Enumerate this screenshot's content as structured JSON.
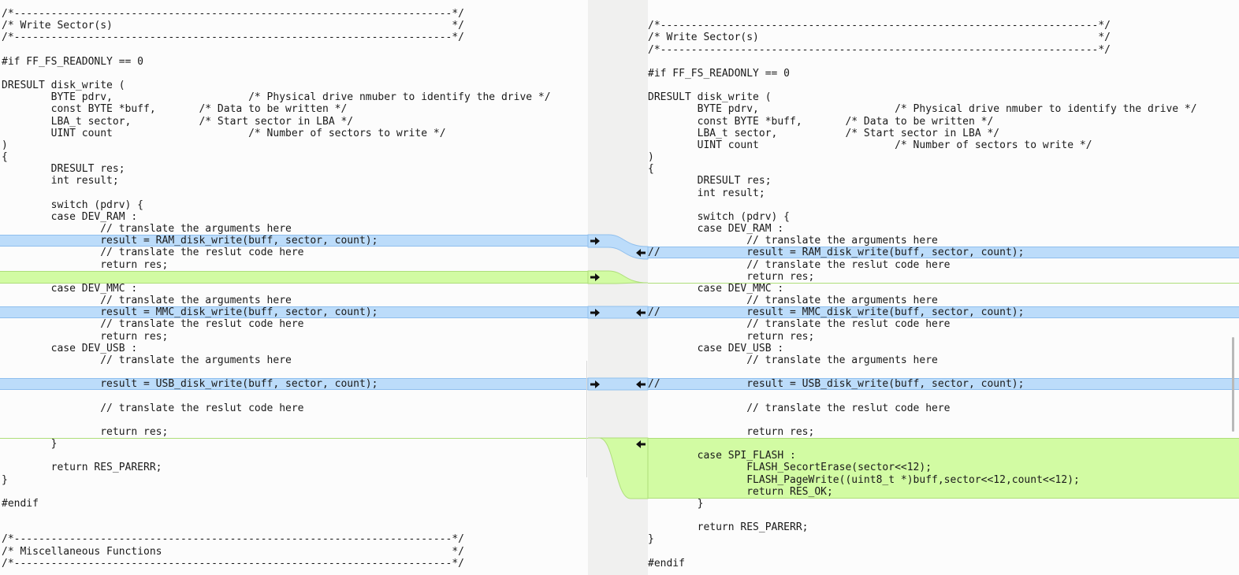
{
  "left": {
    "lines": [
      "/*-----------------------------------------------------------------------*/",
      "/* Write Sector(s)                                                       */",
      "/*-----------------------------------------------------------------------*/",
      "",
      "#if FF_FS_READONLY == 0",
      "",
      "DRESULT disk_write (",
      "        BYTE pdrv,                      /* Physical drive nmuber to identify the drive */",
      "        const BYTE *buff,       /* Data to be written */",
      "        LBA_t sector,           /* Start sector in LBA */",
      "        UINT count                      /* Number of sectors to write */",
      ")",
      "{",
      "        DRESULT res;",
      "        int result;",
      "",
      "        switch (pdrv) {",
      "        case DEV_RAM :",
      "                // translate the arguments here",
      "                result = RAM_disk_write(buff, sector, count);",
      "                // translate the reslut code here",
      "                return res;",
      "",
      "        case DEV_MMC :",
      "                // translate the arguments here",
      "                result = MMC_disk_write(buff, sector, count);",
      "                // translate the reslut code here",
      "                return res;",
      "        case DEV_USB :",
      "                // translate the arguments here",
      "",
      "                result = USB_disk_write(buff, sector, count);",
      "",
      "                // translate the reslut code here",
      "",
      "                return res;",
      "        }",
      "",
      "        return RES_PARERR;",
      "}",
      "",
      "#endif",
      "",
      "",
      "/*-----------------------------------------------------------------------*/",
      "/* Miscellaneous Functions                                               */",
      "/*-----------------------------------------------------------------------*/"
    ]
  },
  "right": {
    "lines": [
      "",
      "/*-----------------------------------------------------------------------*/",
      "/* Write Sector(s)                                                       */",
      "/*-----------------------------------------------------------------------*/",
      "",
      "#if FF_FS_READONLY == 0",
      "",
      "DRESULT disk_write (",
      "        BYTE pdrv,                      /* Physical drive nmuber to identify the drive */",
      "        const BYTE *buff,       /* Data to be written */",
      "        LBA_t sector,           /* Start sector in LBA */",
      "        UINT count                      /* Number of sectors to write */",
      ")",
      "{",
      "        DRESULT res;",
      "        int result;",
      "",
      "        switch (pdrv) {",
      "        case DEV_RAM :",
      "                // translate the arguments here",
      "//              result = RAM_disk_write(buff, sector, count);",
      "                // translate the reslut code here",
      "                return res;",
      "        case DEV_MMC :",
      "                // translate the arguments here",
      "//              result = MMC_disk_write(buff, sector, count);",
      "                // translate the reslut code here",
      "                return res;",
      "        case DEV_USB :",
      "                // translate the arguments here",
      "",
      "//              result = USB_disk_write(buff, sector, count);",
      "",
      "                // translate the reslut code here",
      "",
      "                return res;",
      "",
      "        case SPI_FLASH :",
      "                FLASH_SecortErase(sector<<12);",
      "                FLASH_PageWrite((uint8_t *)buff,sector<<12,count<<12);",
      "                return RES_OK;",
      "        }",
      "",
      "        return RES_PARERR;",
      "}",
      "",
      "#endif"
    ]
  },
  "icons": {
    "copy_to_right": "arrow-right-icon",
    "copy_to_left": "arrow-left-icon"
  },
  "colors": {
    "changed": "#bcdcfa",
    "inserted": "#d2fba3"
  }
}
